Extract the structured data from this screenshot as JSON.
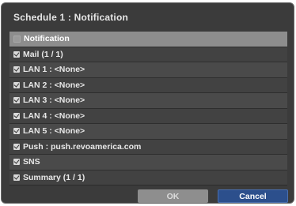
{
  "dialog": {
    "title": "Schedule 1 : Notification"
  },
  "list": {
    "header": {
      "label": "Notification",
      "checked": false
    },
    "items": [
      {
        "label": "Mail (1 / 1)",
        "checked": true
      },
      {
        "label": "LAN 1 : <None>",
        "checked": true
      },
      {
        "label": "LAN 2 : <None>",
        "checked": true
      },
      {
        "label": "LAN 3 : <None>",
        "checked": true
      },
      {
        "label": "LAN 4 : <None>",
        "checked": true
      },
      {
        "label": "LAN 5 : <None>",
        "checked": true
      },
      {
        "label": "Push : push.revoamerica.com",
        "checked": true
      },
      {
        "label": "SNS",
        "checked": true
      },
      {
        "label": "Summary (1 / 1)",
        "checked": true
      }
    ]
  },
  "buttons": {
    "ok_label": "OK",
    "cancel_label": "Cancel"
  },
  "colors": {
    "cancel_accent": "#2c4f8c",
    "dialog_background": "#3b3b3b"
  }
}
